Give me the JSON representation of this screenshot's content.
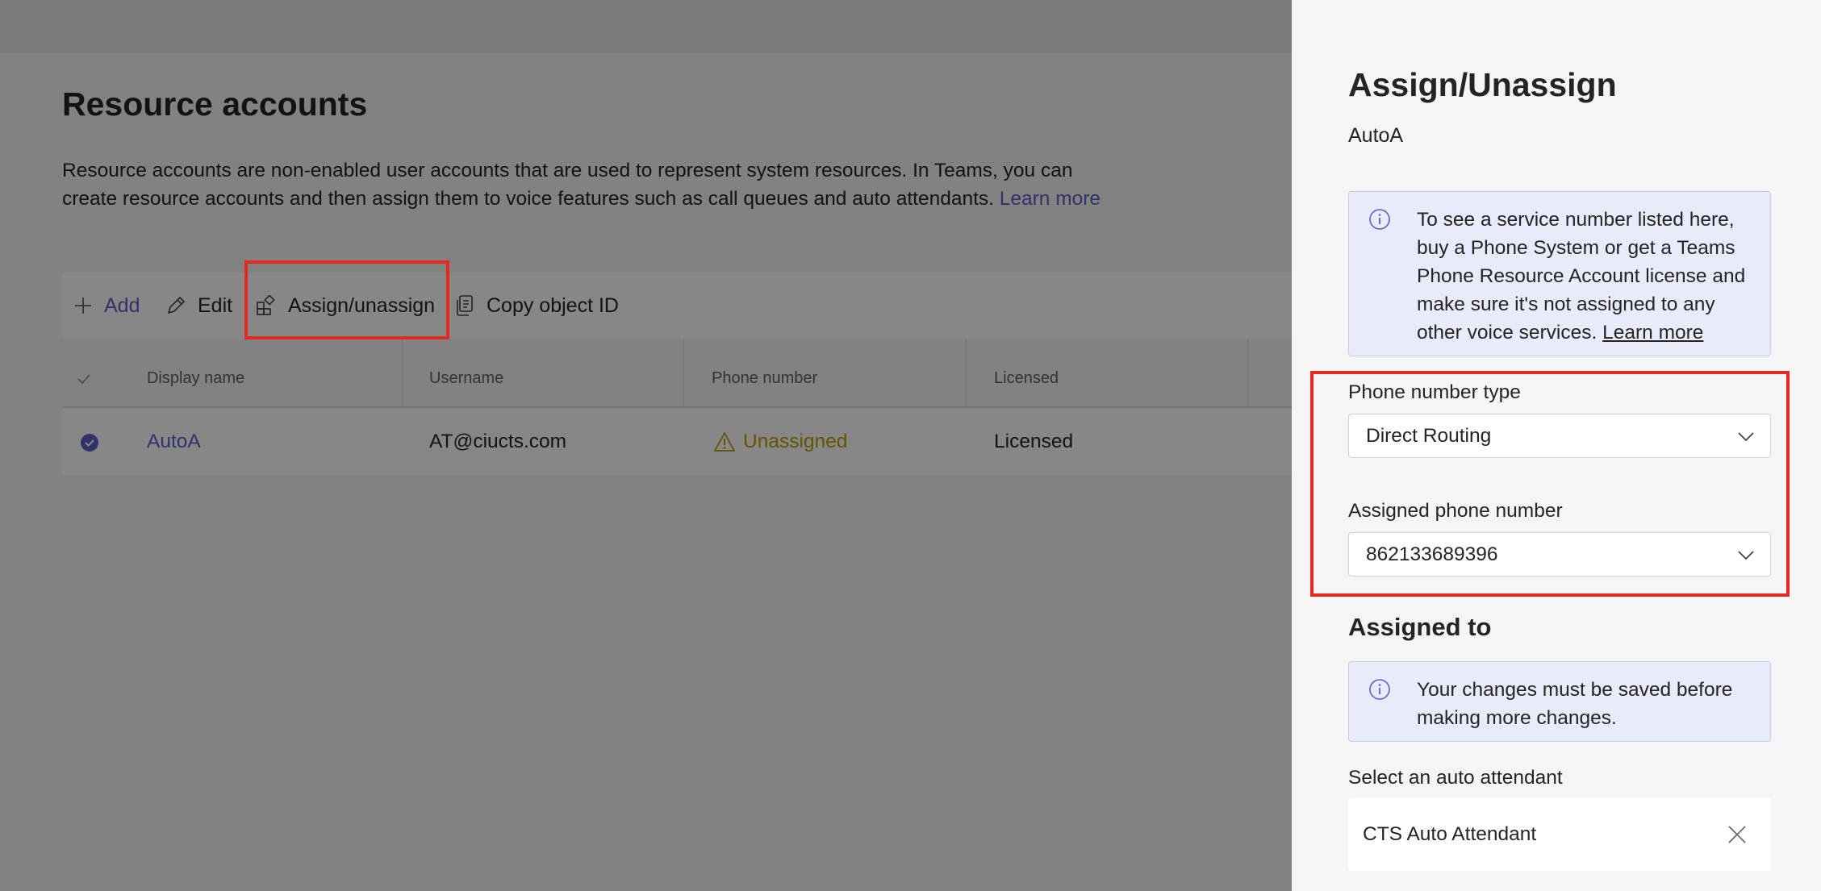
{
  "page": {
    "title": "Resource accounts",
    "description": "Resource accounts are non-enabled user accounts that are used to represent system resources. In Teams, you can create resource accounts and then assign them to voice features such as call queues and auto attendants.",
    "learn_more": "Learn more"
  },
  "toolbar": {
    "add_label": "Add",
    "edit_label": "Edit",
    "assign_label": "Assign/unassign",
    "copy_label": "Copy object ID"
  },
  "table": {
    "columns": [
      "Display name",
      "Username",
      "Phone number",
      "Licensed"
    ],
    "rows": [
      {
        "selected": true,
        "display_name": "AutoA",
        "username": "AT@ciucts.com",
        "phone_number": "Unassigned",
        "licensed": "Licensed"
      }
    ]
  },
  "panel": {
    "title": "Assign/Unassign",
    "subtitle": "AutoA",
    "info_text": "To see a service number listed here, buy a Phone System or get a Teams Phone Resource Account license and make sure it's not assigned to any other voice services.",
    "info_link": "Learn more",
    "phone_type_label": "Phone number type",
    "phone_type_value": "Direct Routing",
    "assigned_number_label": "Assigned phone number",
    "assigned_number_value": "862133689396",
    "assigned_to_title": "Assigned to",
    "save_notice": "Your changes must be saved before making more changes.",
    "auto_attendant_label": "Select an auto attendant",
    "auto_attendant_value": "CTS Auto Attendant"
  },
  "colors": {
    "accent": "#5b5fc7",
    "warning": "#c19c00",
    "highlight": "#e8271f",
    "info_bg": "#e8ebfa"
  },
  "icons": [
    "plus-icon",
    "pencil-icon",
    "assign-icon",
    "copy-icon",
    "check-icon",
    "checkmark-circle-icon",
    "warning-icon",
    "info-icon",
    "chevron-down-icon",
    "close-icon"
  ]
}
